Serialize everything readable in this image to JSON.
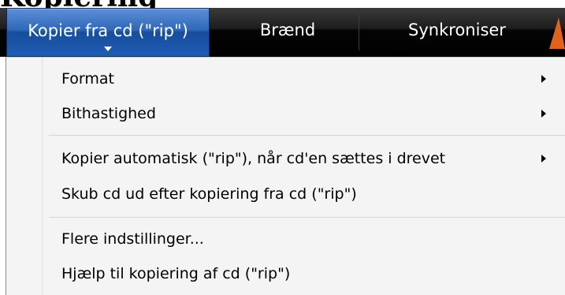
{
  "page_title": "Kopiering",
  "toolbar": {
    "tabs": [
      {
        "label": "Kopier fra cd (\"rip\")"
      },
      {
        "label": "Brænd"
      },
      {
        "label": "Synkroniser"
      }
    ]
  },
  "menu": {
    "items": [
      {
        "label": "Format",
        "has_submenu": true
      },
      {
        "label": "Bithastighed",
        "has_submenu": true
      },
      {
        "label": "Kopier automatisk (\"rip\"), når cd'en sættes i drevet",
        "has_submenu": true
      },
      {
        "label": "Skub cd ud efter kopiering fra cd (\"rip\")",
        "has_submenu": false
      },
      {
        "label": "Flere indstillinger...",
        "has_submenu": false
      },
      {
        "label": "Hjælp til kopiering af cd (\"rip\")",
        "has_submenu": false
      }
    ]
  },
  "colors": {
    "active_tab": "#2e68b8",
    "toolbar_bg": "#000000",
    "menu_bg": "#f4f4f4"
  }
}
